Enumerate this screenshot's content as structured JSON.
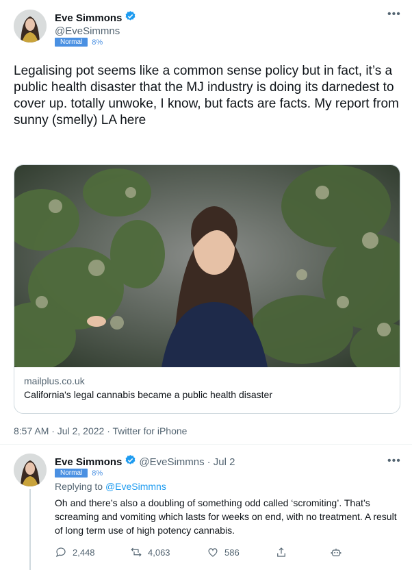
{
  "main_tweet": {
    "author_name": "Eve Simmons",
    "author_handle": "@EveSimmns",
    "badge_label": "Normal",
    "badge_percent": "8%",
    "more_icon": "ellipsis-icon",
    "text": "Legalising pot seems like a common sense policy but in fact, it’s a public health disaster that the MJ industry is doing its darnedest to cover up. totally unwoke, I know, but facts are facts. My report from sunny (smelly) LA here",
    "card": {
      "domain": "mailplus.co.uk",
      "title": "California's legal cannabis became a public health disaster"
    },
    "timestamp": "8:57 AM · Jul 2, 2022 · Twitter for iPhone"
  },
  "reply_tweet": {
    "author_name": "Eve Simmons",
    "author_handle": "@EveSimmns",
    "date": "· Jul 2",
    "badge_label": "Normal",
    "badge_percent": "8%",
    "replying_to_label": "Replying to",
    "replying_to_handle": "@EveSimmns",
    "text": "Oh and there’s also a doubling of something odd called ‘scromiting’. That’s screaming and vomiting which lasts for weeks on end, with no treatment. A result of long term use of high potency cannabis.",
    "actions": {
      "replies": "2,448",
      "retweets": "4,063",
      "likes": "586"
    }
  },
  "colors": {
    "verified": "#1d9bf0",
    "badge": "#4a90e2",
    "link": "#1d9bf0",
    "muted": "#536471"
  }
}
